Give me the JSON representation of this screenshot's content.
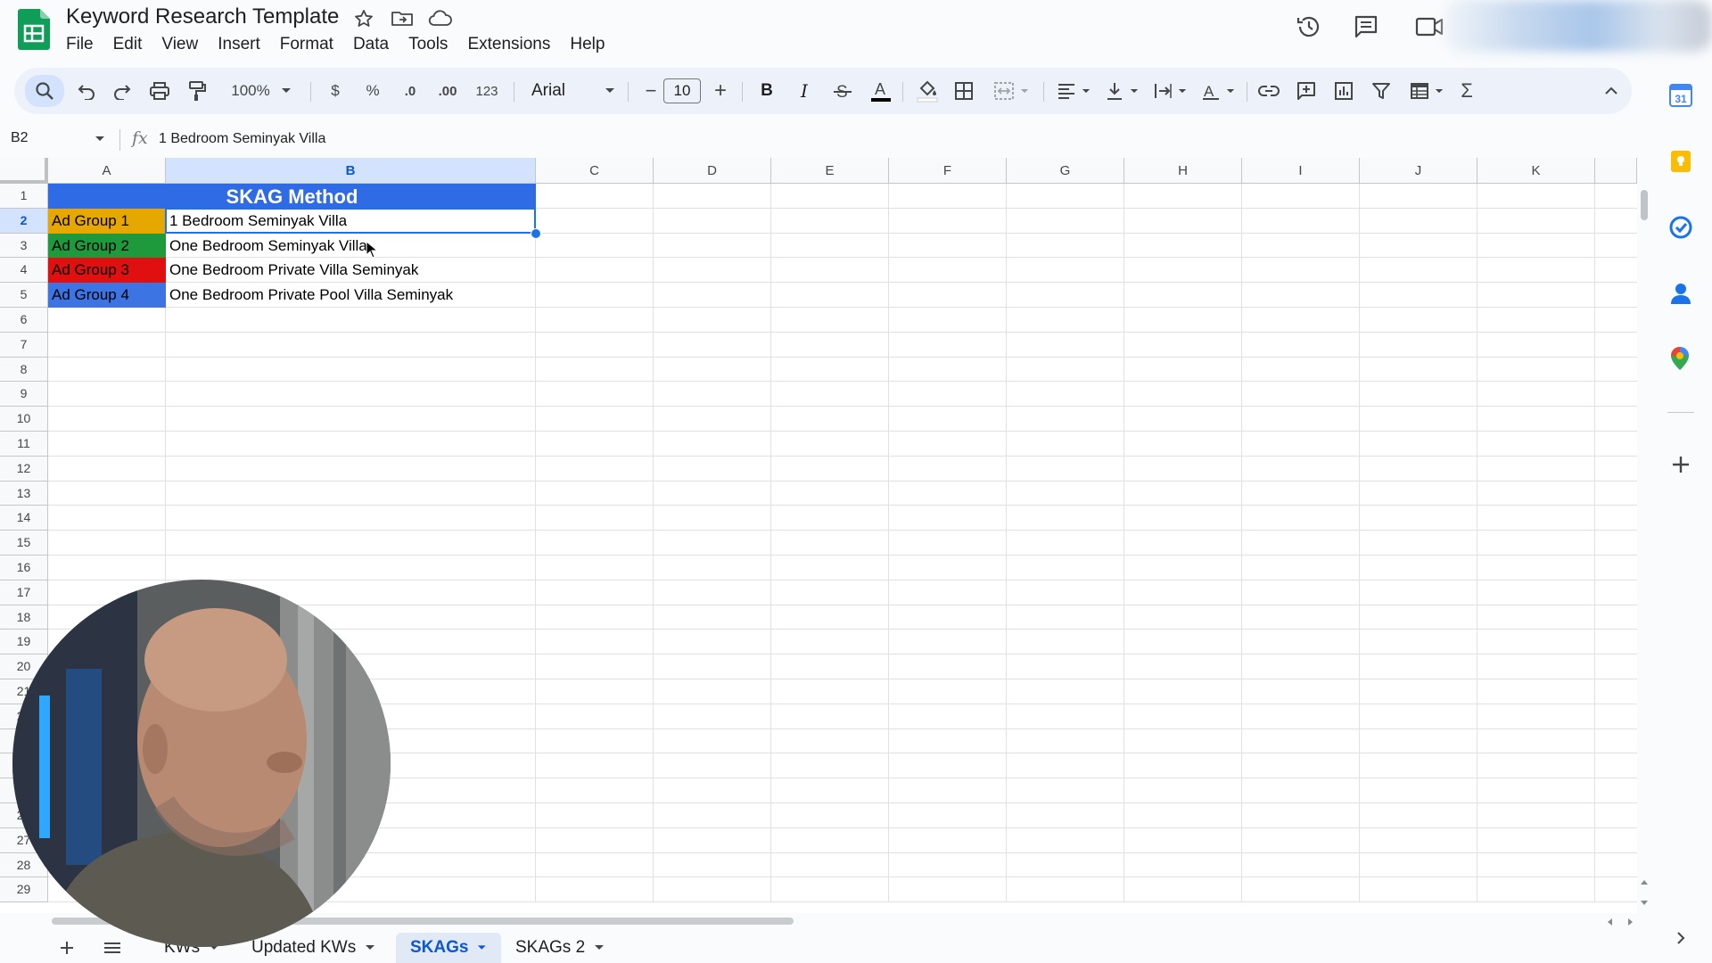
{
  "app": {
    "doc_title": "Keyword Research Template",
    "menu": [
      "File",
      "Edit",
      "View",
      "Insert",
      "Format",
      "Data",
      "Tools",
      "Extensions",
      "Help"
    ]
  },
  "toolbar": {
    "zoom": "100%",
    "currency": "$",
    "percent": "%",
    "decrease_decimal": ".0",
    "increase_decimal": ".00",
    "number_format": "123",
    "font": "Arial",
    "font_size": "10",
    "minus": "−",
    "plus": "+",
    "bold": "B",
    "italic": "I",
    "sigma": "Σ"
  },
  "formula_bar": {
    "name_box": "B2",
    "fx": "fx",
    "content": "1 Bedroom Seminyak Villa"
  },
  "grid": {
    "columns": [
      "A",
      "B",
      "C",
      "D",
      "E",
      "F",
      "G",
      "H",
      "I",
      "J",
      "K"
    ],
    "selected_column": "B",
    "rows": [
      "1",
      "2",
      "3",
      "4",
      "5",
      "6",
      "7",
      "8",
      "9",
      "10",
      "11",
      "12",
      "13",
      "14",
      "15",
      "16",
      "17",
      "18",
      "19",
      "20",
      "21",
      "22",
      "23",
      "24",
      "25",
      "26",
      "27",
      "28",
      "29"
    ],
    "selected_row": "2",
    "title_cell": "SKAG Method",
    "ad_groups": [
      {
        "label": "Ad Group 1",
        "keyword": "1 Bedroom Seminyak Villa",
        "color": "#e6a700"
      },
      {
        "label": "Ad Group 2",
        "keyword": "One Bedroom Seminyak Villa",
        "color": "#1e9a3c"
      },
      {
        "label": "Ad Group 3",
        "keyword": "One Bedroom Private Villa Seminyak",
        "color": "#e01010"
      },
      {
        "label": "Ad Group 4",
        "keyword": "One Bedroom Private Pool Villa Seminyak",
        "color": "#3c74e3"
      }
    ],
    "header_fill": "#2f6be4"
  },
  "sheet_tabs": [
    {
      "label": "KWs",
      "active": false
    },
    {
      "label": "Updated KWs",
      "active": false
    },
    {
      "label": "SKAGs",
      "active": true
    },
    {
      "label": "SKAGs 2",
      "active": false
    }
  ],
  "side_panel": {
    "calendar_day": "31",
    "icons": [
      "calendar-icon",
      "keep-icon",
      "tasks-icon",
      "contacts-icon",
      "maps-icon",
      "add-icon"
    ]
  },
  "colors": {
    "accent": "#0b57d0",
    "selection": "#1a73e8",
    "sheets_green": "#0f9d58"
  }
}
